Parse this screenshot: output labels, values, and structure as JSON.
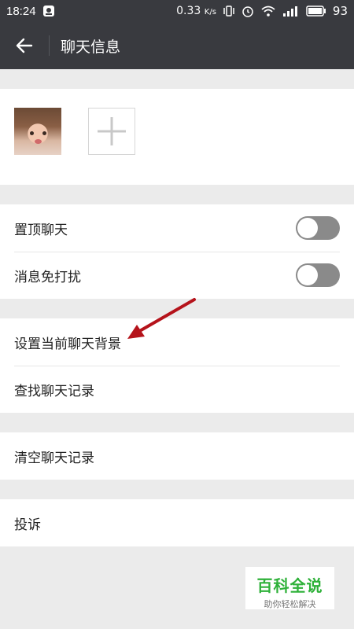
{
  "status_bar": {
    "time": "18:24",
    "network_speed": "0.33",
    "network_unit": "K/s",
    "battery": "93"
  },
  "app_bar": {
    "back_icon": "arrow-left-icon",
    "title": "聊天信息"
  },
  "settings": {
    "pin_chat": {
      "label": "置顶聊天",
      "enabled": false
    },
    "mute_notifications": {
      "label": "消息免打扰",
      "enabled": false
    },
    "set_background": "设置当前聊天背景",
    "search_history": "查找聊天记录",
    "clear_history": "清空聊天记录",
    "report": "投诉"
  },
  "watermark": {
    "main": "百科全说",
    "sub": "助你轻松解决"
  },
  "colors": {
    "header_bg": "#393a3f",
    "page_bg": "#ebebeb",
    "annotation_arrow": "#b5131b",
    "watermark_green": "#2eb139"
  }
}
